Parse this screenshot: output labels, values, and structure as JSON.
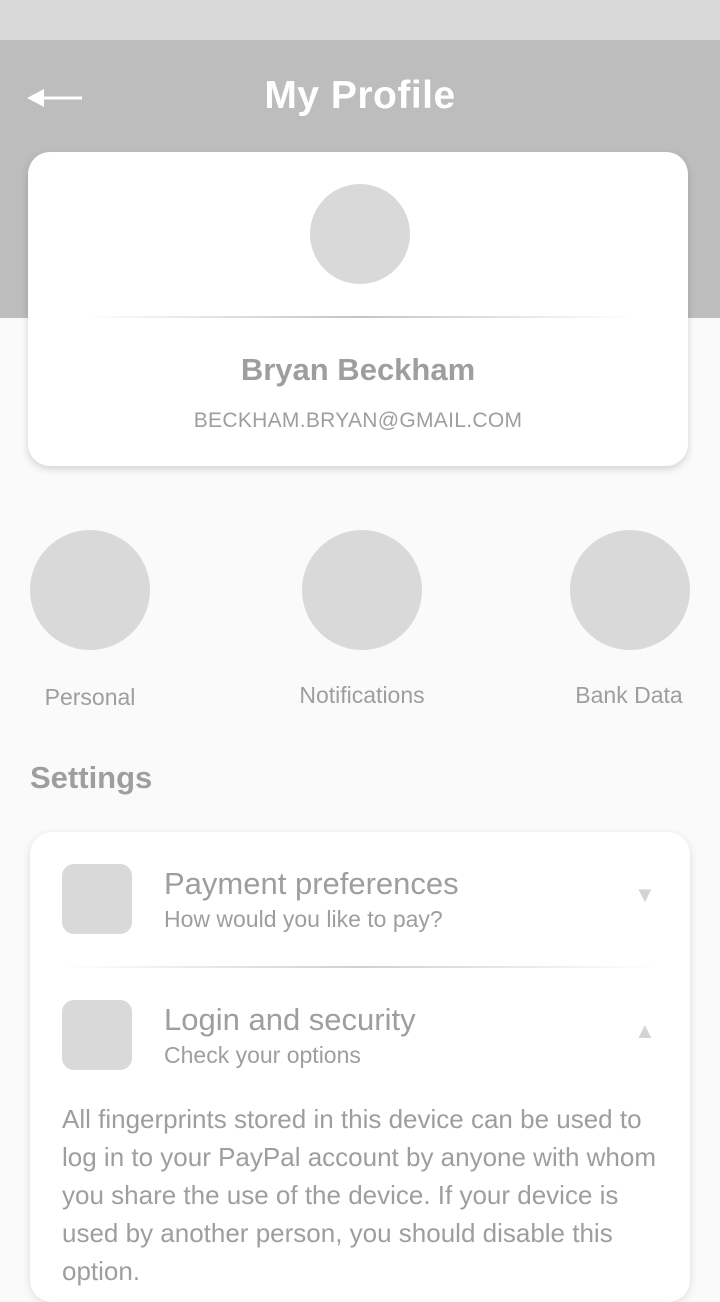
{
  "header": {
    "title": "My Profile",
    "back_icon": "arrow-left-icon"
  },
  "profile": {
    "name": "Bryan Beckham",
    "email": "BECKHAM.BRYAN@GMAIL.COM"
  },
  "quick_links": [
    {
      "label": "Personal"
    },
    {
      "label": "Notifications"
    },
    {
      "label": "Bank Data"
    }
  ],
  "settings": {
    "title": "Settings",
    "items": [
      {
        "title": "Payment preferences",
        "subtitle": "How would you like to pay?",
        "chevron": "▼",
        "expanded": false
      },
      {
        "title": "Login and security",
        "subtitle": "Check your options",
        "chevron": "▲",
        "expanded": true,
        "detail": "All fingerprints stored in this device can be used to log in to your PayPal account by anyone with whom you share the use of the device. If your device is used by another person, you should disable this option."
      }
    ]
  },
  "colors": {
    "header_bg": "#bdbdbd",
    "status_bar": "#d9d9d9",
    "placeholder": "#d9d9d9",
    "text_gray": "#9e9e9e",
    "page_bg": "#fafafa"
  }
}
